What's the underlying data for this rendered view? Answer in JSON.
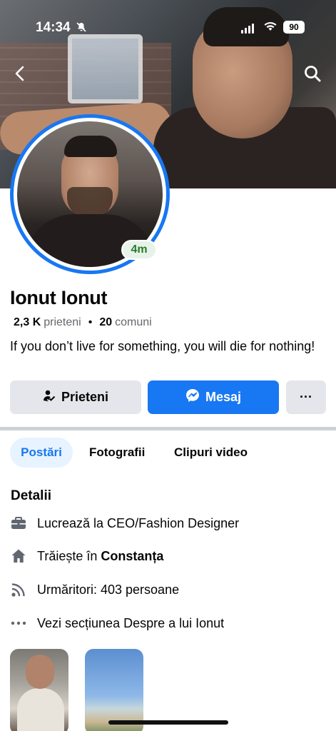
{
  "status_bar": {
    "time": "14:34",
    "battery": "90"
  },
  "profile": {
    "name": "Ionut Ionut",
    "story_age": "4m",
    "friends_count": "2,3 K",
    "friends_label": "prieteni",
    "separator": "•",
    "mutual_count": "20",
    "mutual_label": "comuni",
    "bio": "If you don’t live for something, you will die for nothing!"
  },
  "actions": {
    "friends_label": "Prieteni",
    "message_label": "Mesaj",
    "more_label": "···"
  },
  "tabs": [
    {
      "label": "Postări",
      "active": true
    },
    {
      "label": "Fotografii",
      "active": false
    },
    {
      "label": "Clipuri video",
      "active": false
    }
  ],
  "details": {
    "title": "Detalii",
    "work": "Lucrează la CEO/Fashion Designer",
    "lives_prefix": "Trăiește în",
    "lives_city": "Constanța",
    "followers": "Urmăritori: 403 persoane",
    "about_link": "Vezi secțiunea Despre a lui Ionut"
  },
  "icons": {
    "back": "chevron-left-icon",
    "search": "search-icon",
    "work": "briefcase-icon",
    "home": "house-icon",
    "followers": "rss-icon",
    "more": "ellipsis-icon",
    "messenger": "messenger-icon",
    "friends": "friend-check-icon"
  },
  "colors": {
    "accent": "#1877f2",
    "story_badge": "#2b7a2e",
    "button_gray": "#e4e6eb"
  }
}
